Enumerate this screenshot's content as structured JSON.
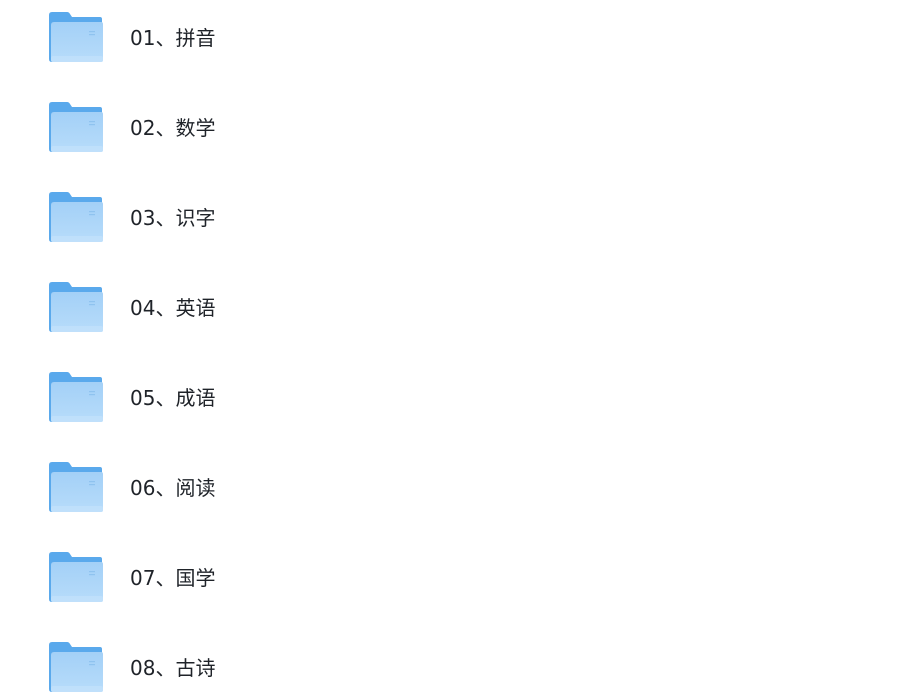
{
  "folders": [
    {
      "name": "01、拼音",
      "icon": "folder-icon"
    },
    {
      "name": "02、数学",
      "icon": "folder-icon"
    },
    {
      "name": "03、识字",
      "icon": "folder-icon"
    },
    {
      "name": "04、英语",
      "icon": "folder-icon"
    },
    {
      "name": "05、成语",
      "icon": "folder-icon"
    },
    {
      "name": "06、阅读",
      "icon": "folder-icon"
    },
    {
      "name": "07、国学",
      "icon": "folder-icon"
    },
    {
      "name": "08、古诗",
      "icon": "folder-icon"
    }
  ],
  "colors": {
    "folder_back": "#5aa9ec",
    "folder_front_top": "#a3d0f7",
    "folder_front_bottom": "#b7dcfa",
    "text": "#1f2329"
  }
}
